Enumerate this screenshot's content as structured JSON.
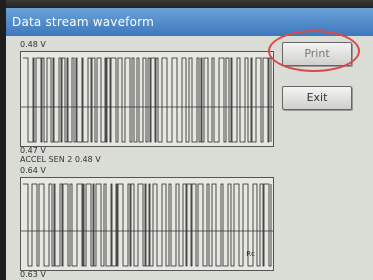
{
  "window": {
    "title": "Data stream waveform"
  },
  "waveform1": {
    "max_label": "0.48 V",
    "min_label": "0.47 V"
  },
  "waveform2": {
    "name_label": "ACCEL SEN 2 0.48 V",
    "max_label": "0.64 V",
    "min_label": "0.63 V",
    "marker": "Rc"
  },
  "buttons": {
    "print": "Print",
    "exit": "Exit"
  },
  "colors": {
    "titlebar": "#4a86c8",
    "highlight_ring": "#d84a4a"
  }
}
